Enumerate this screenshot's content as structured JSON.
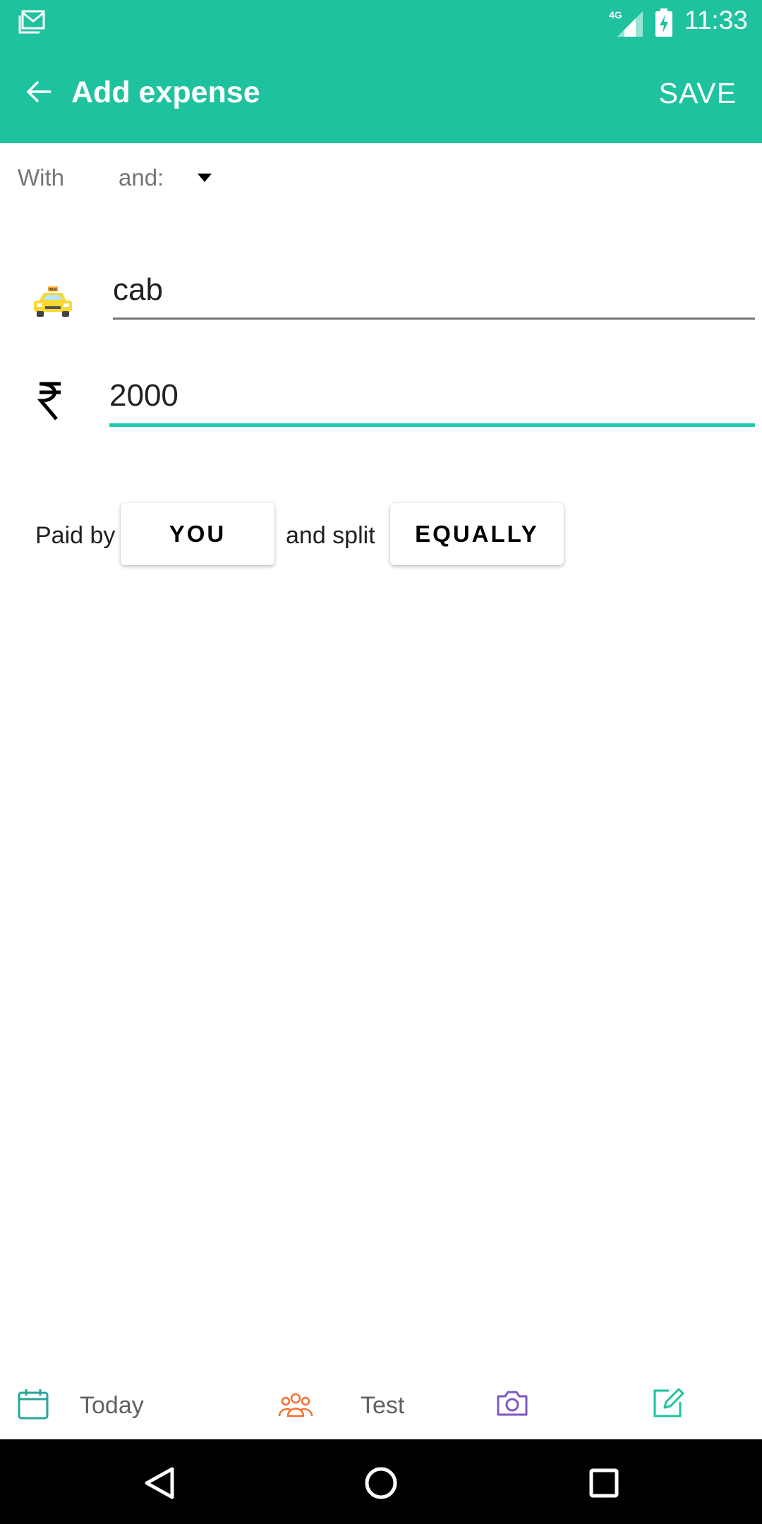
{
  "status_bar": {
    "time": "11:33",
    "network": "4G",
    "icons": [
      "gmail-icon",
      "signal-icon",
      "battery-charging-icon"
    ]
  },
  "app_bar": {
    "title": "Add expense",
    "save_label": "SAVE",
    "back_icon": "arrow-left-icon",
    "color": "#1fc29e"
  },
  "with_row": {
    "with_label": "With",
    "and_label": "and:",
    "dropdown_icon": "caret-down-icon"
  },
  "expense": {
    "category_icon": "taxi-icon",
    "description": "cab",
    "currency_icon": "rupee-icon",
    "amount": "2000",
    "accent_color": "#1fc9b0"
  },
  "payment": {
    "paid_by_label": "Paid by",
    "payer": "YOU",
    "split_label": "and split",
    "split_method": "EQUALLY"
  },
  "bottom_bar": {
    "date_label": "Today",
    "group_name": "Test",
    "icons": [
      "calendar-icon",
      "group-icon",
      "camera-icon",
      "note-icon"
    ]
  },
  "nav_bar": {
    "icons": [
      "back-triangle-icon",
      "home-circle-icon",
      "recents-square-icon"
    ]
  }
}
